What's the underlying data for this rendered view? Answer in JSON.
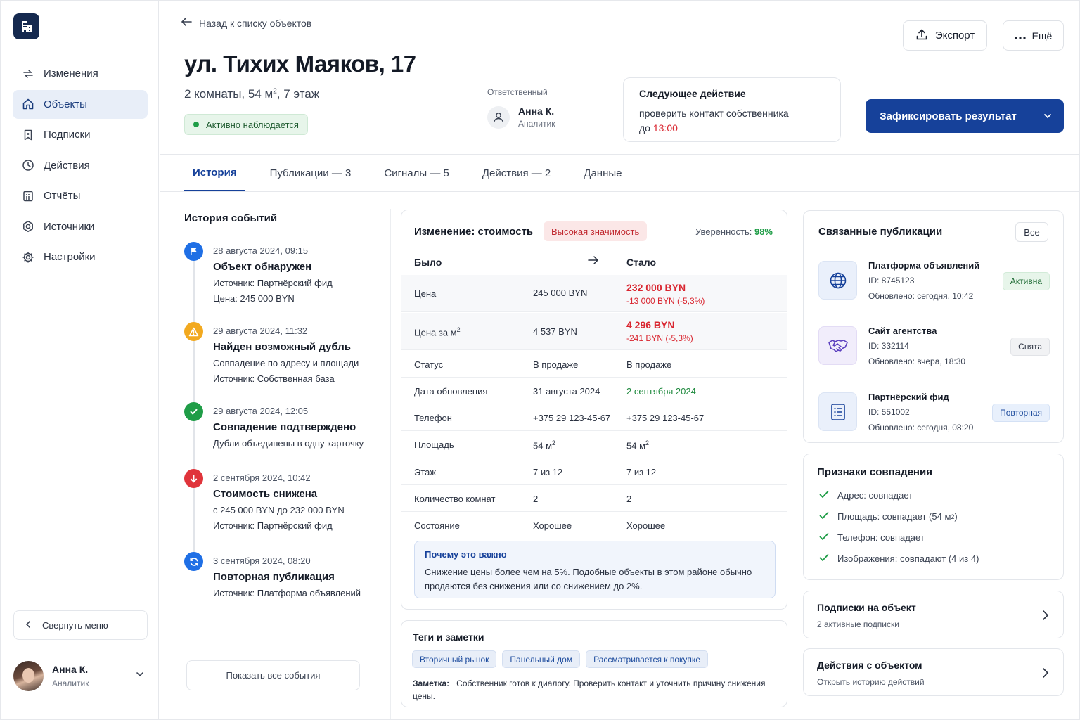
{
  "sidebar": {
    "items": [
      {
        "label": "Изменения",
        "icon": "changes-icon",
        "active": false
      },
      {
        "label": "Объекты",
        "icon": "home-icon",
        "active": true
      },
      {
        "label": "Подписки",
        "icon": "bookmark-icon",
        "active": false
      },
      {
        "label": "Действия",
        "icon": "clock-icon",
        "active": false
      },
      {
        "label": "Отчёты",
        "icon": "report-icon",
        "active": false
      },
      {
        "label": "Источники",
        "icon": "source-icon",
        "active": false
      },
      {
        "label": "Настройки",
        "icon": "gear-icon",
        "active": false
      }
    ],
    "collapse_label": "Свернуть меню",
    "user": {
      "name": "Анна К.",
      "role": "Аналитик"
    }
  },
  "header": {
    "back_label": "Назад к списку объектов",
    "title": "ул. Тихих Маяков, 17",
    "subtitle_pre": "2 комнаты, 54 м",
    "subtitle_sup": "2",
    "subtitle_post": ", 7 этаж",
    "status": "Активно наблюдается",
    "responsible_label": "Ответственный",
    "responsible_name": "Анна К.",
    "responsible_role": "Аналитик",
    "next_title": "Следующее действие",
    "next_text": "проверить контакт собственника",
    "next_prefix": "до ",
    "next_time": "13:00",
    "export_label": "Экспорт",
    "more_label": "Ещё",
    "primary_label": "Зафиксировать результат"
  },
  "tabs": [
    {
      "label": "История",
      "active": true
    },
    {
      "label": "Публикации — 3",
      "active": false
    },
    {
      "label": "Сигналы — 5",
      "active": false
    },
    {
      "label": "Действия — 2",
      "active": false
    },
    {
      "label": "Данные",
      "active": false
    }
  ],
  "history": {
    "title": "История событий",
    "events": [
      {
        "date": "28 августа 2024, 09:15",
        "title": "Объект обнаружен",
        "lines": [
          "Источник: Партнёрский фид",
          "Цена: 245 000 BYN"
        ],
        "icon": "flag-icon",
        "color": "#1f6fe5"
      },
      {
        "date": "29 августа 2024, 11:32",
        "title": "Найден возможный дубль",
        "lines": [
          "Совпадение по адресу и площади",
          "Источник: Собственная база"
        ],
        "icon": "warning-icon",
        "color": "#f2a91f"
      },
      {
        "date": "29 августа 2024, 12:05",
        "title": "Совпадение подтверждено",
        "lines": [
          "Дубли объединены в одну карточку"
        ],
        "icon": "check-icon",
        "color": "#1f9d47"
      },
      {
        "date": "2 сентября 2024, 10:42",
        "title": "Стоимость снижена",
        "lines": [
          "с 245 000 BYN до 232 000 BYN",
          "Источник: Партнёрский фид"
        ],
        "icon": "arrow-down-icon",
        "color": "#e0343b"
      },
      {
        "date": "3 сентября 2024, 08:20",
        "title": "Повторная публикация",
        "lines": [
          "Источник: Платформа объявлений"
        ],
        "icon": "refresh-icon",
        "color": "#1f6fe5"
      }
    ],
    "show_all": "Показать все события"
  },
  "change": {
    "title": "Изменение: стоимость",
    "badge": "Высокая значимость",
    "confidence_label": "Уверенность: ",
    "confidence_value": "98%",
    "col_was": "Было",
    "col_now": "Стало",
    "rows": [
      {
        "field": "Цена",
        "was": "245 000 BYN",
        "now": "232 000 BYN",
        "now_sub": "-13 000 BYN (-5,3%)",
        "style": "red"
      },
      {
        "field": "Цена за м",
        "field_sup": "2",
        "was": "4 537 BYN",
        "now": "4 296 BYN",
        "now_sub": "-241 BYN (-5,3%)",
        "style": "red"
      },
      {
        "field": "Статус",
        "was": "В продаже",
        "now": "В продаже",
        "style": ""
      },
      {
        "field": "Дата обновления",
        "was": "31 августа 2024",
        "now": "2 сентября 2024",
        "style": "green"
      },
      {
        "field": "Телефон",
        "was": "+375 29 123-45-67",
        "now": "+375 29 123-45-67",
        "style": ""
      },
      {
        "field": "Площадь",
        "was": "54 м",
        "was_sup": "2",
        "now": "54 м",
        "now_sup": "2",
        "style": ""
      },
      {
        "field": "Этаж",
        "was": "7 из 12",
        "now": "7 из 12",
        "style": ""
      },
      {
        "field": "Количество комнат",
        "was": "2",
        "now": "2",
        "style": ""
      },
      {
        "field": "Состояние",
        "was": "Хорошее",
        "now": "Хорошее",
        "style": ""
      }
    ],
    "why_title": "Почему это важно",
    "why_text": "Снижение цены более чем на 5%. Подобные объекты в этом районе обычно продаются без снижения или со снижением до 2%."
  },
  "tags": {
    "title": "Теги и заметки",
    "items": [
      "Вторичный рынок",
      "Панельный дом",
      "Рассматривается к покупке"
    ],
    "note_label": "Заметка:",
    "note_text": "Собственник готов к диалогу. Проверить контакт и уточнить причину снижения цены."
  },
  "related": {
    "title": "Связанные публикации",
    "all_label": "Все",
    "items": [
      {
        "name": "Платформа объявлений",
        "id": "ID: 8745123",
        "updated": "Обновлено: сегодня, 10:42",
        "badge": "Активна",
        "badge_style": "green",
        "icon": "globe-icon"
      },
      {
        "name": "Сайт агентства",
        "id": "ID: 332114",
        "updated": "Обновлено: вчера, 18:30",
        "badge": "Снята",
        "badge_style": "gray",
        "icon": "handshake-icon"
      },
      {
        "name": "Партнёрский фид",
        "id": "ID: 551002",
        "updated": "Обновлено: сегодня, 08:20",
        "badge": "Повторная",
        "badge_style": "blue",
        "icon": "list-icon"
      }
    ]
  },
  "match": {
    "title": "Признаки совпадения",
    "items": [
      {
        "label": "Адрес:",
        "value": "совпадает"
      },
      {
        "label": "Площадь:",
        "value": "совпадает (54 м",
        "sup": "2",
        "post": ")"
      },
      {
        "label": "Телефон:",
        "value": "совпадает"
      },
      {
        "label": "Изображения:",
        "value": "совпадают (4 из 4)"
      }
    ]
  },
  "links": [
    {
      "title": "Подписки на объект",
      "sub": "2 активные подписки"
    },
    {
      "title": "Действия с объектом",
      "sub": "Открыть историю действий"
    }
  ],
  "colors": {
    "primary": "#16419a",
    "danger": "#d9252f",
    "success": "#1f9d47"
  }
}
